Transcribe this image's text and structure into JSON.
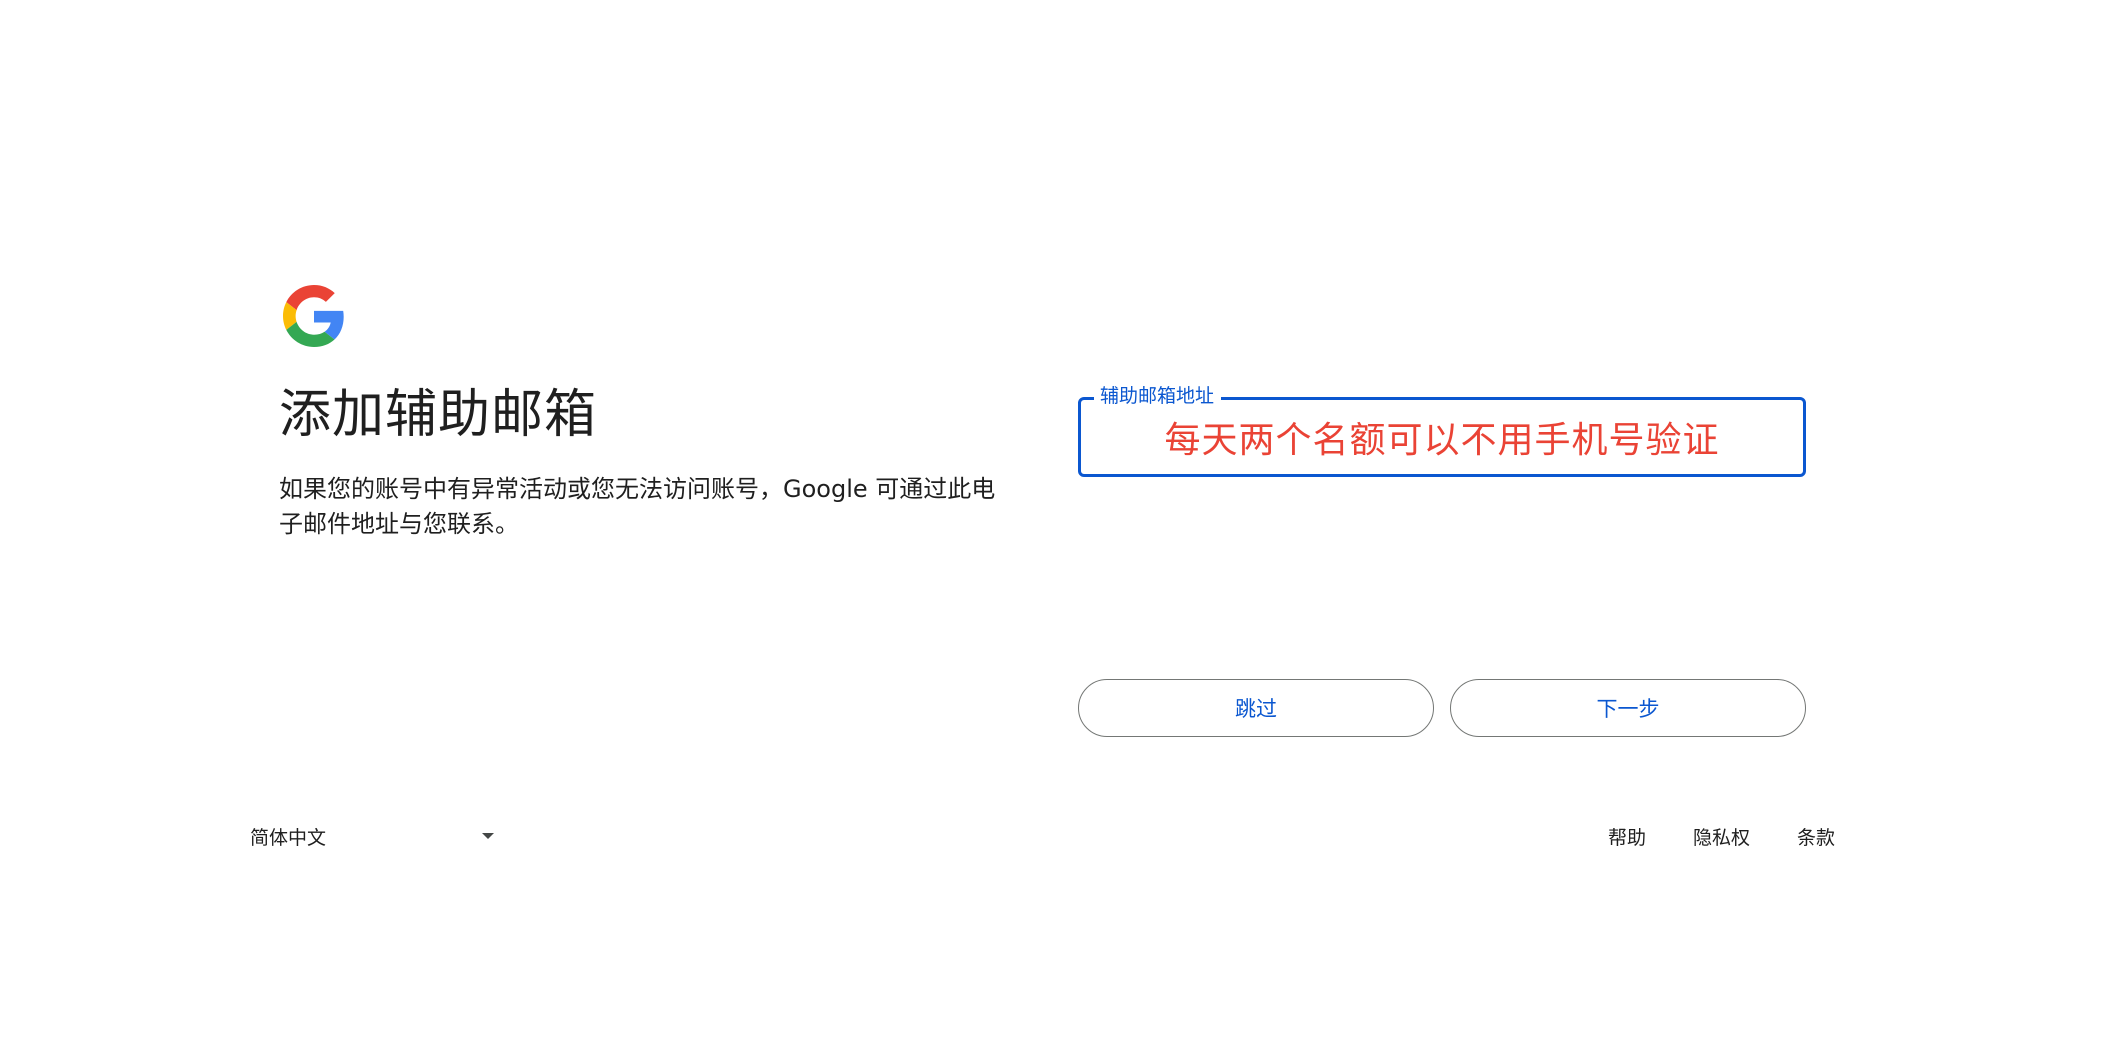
{
  "header": {
    "logo_icon": "google-g-icon",
    "title": "添加辅助邮箱",
    "description": "如果您的账号中有异常活动或您无法访问账号，Google 可通过此电子邮件地址与您联系。"
  },
  "form": {
    "recovery_email": {
      "label": "辅助邮箱地址",
      "value": "每天两个名额可以不用手机号验证"
    },
    "skip_label": "跳过",
    "next_label": "下一步"
  },
  "footer": {
    "language": "简体中文",
    "language_icon": "caret-down-icon",
    "links": [
      "帮助",
      "隐私权",
      "条款"
    ]
  },
  "colors": {
    "accent": "#0b57d0",
    "annotation_text": "#ea4335",
    "text": "#1f1f1f",
    "button_border": "#747775"
  }
}
